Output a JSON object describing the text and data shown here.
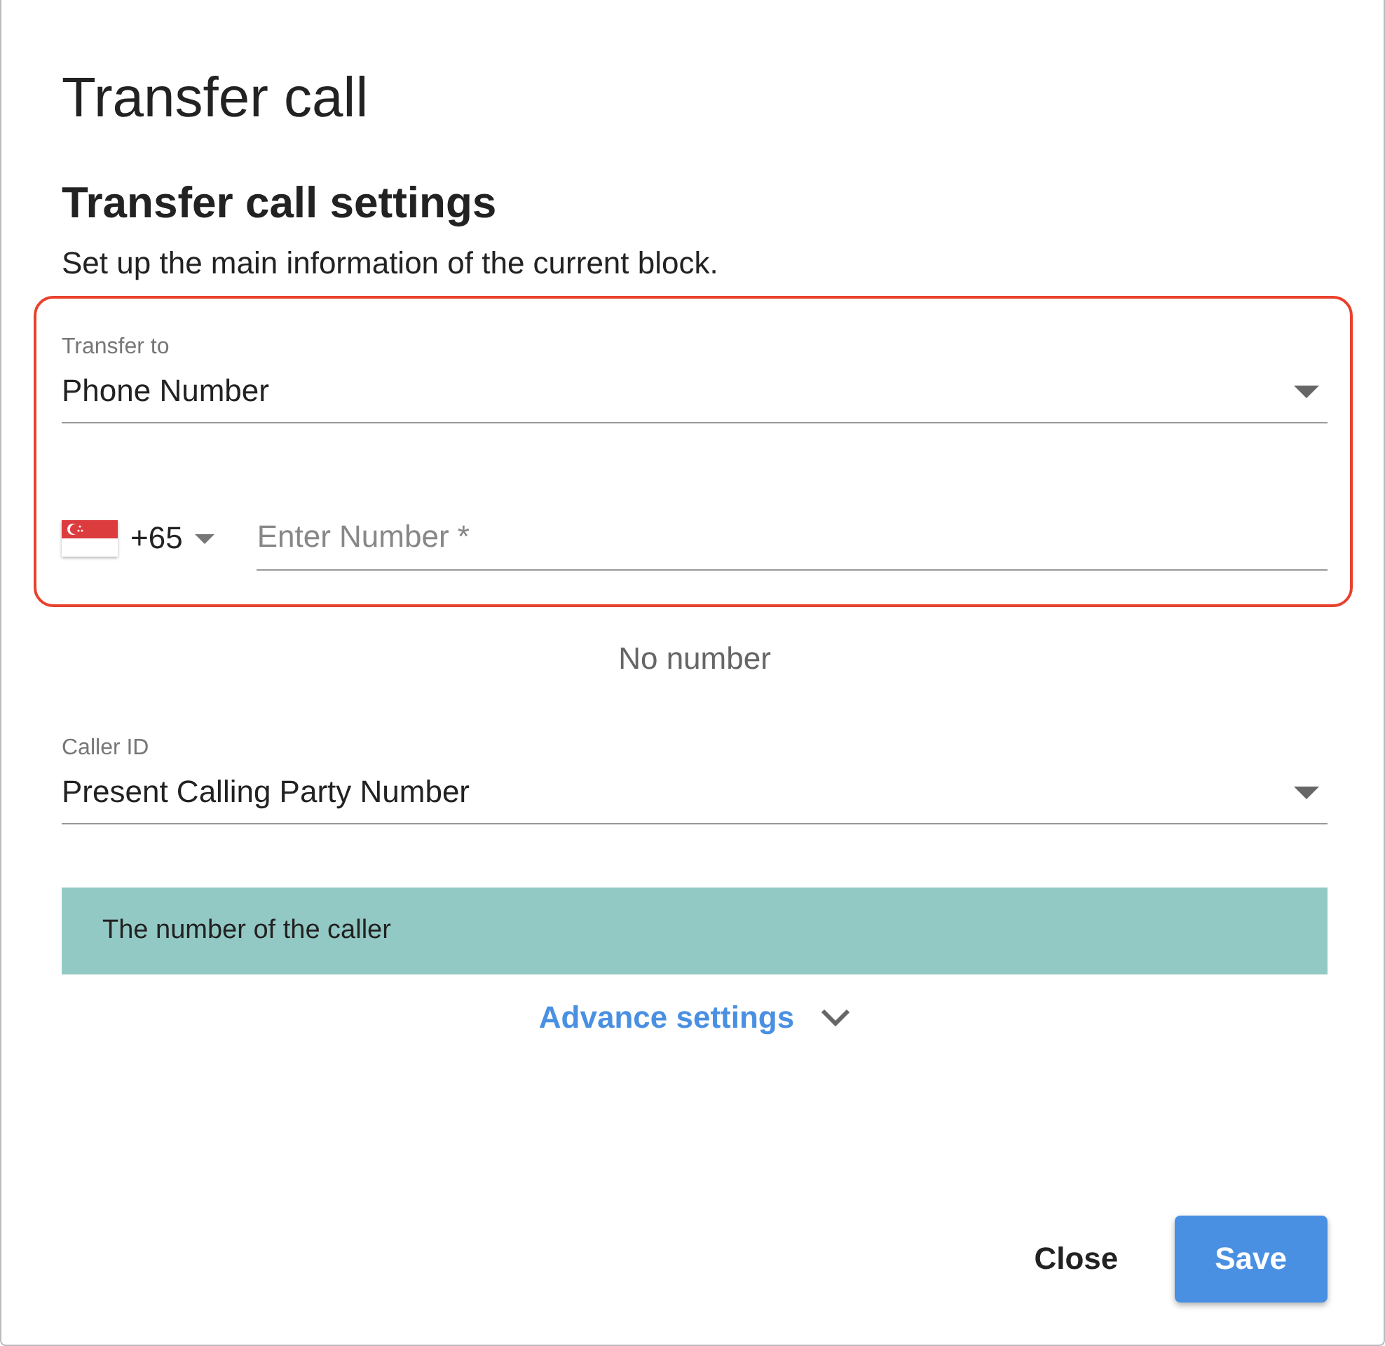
{
  "dialog": {
    "title": "Transfer call"
  },
  "section": {
    "heading": "Transfer call settings",
    "description": "Set up the main information of the current block."
  },
  "transfer_to": {
    "label": "Transfer to",
    "value": "Phone Number"
  },
  "phone": {
    "country_code": "+65",
    "placeholder": "Enter Number *"
  },
  "phone_status": "No number",
  "caller_id": {
    "label": "Caller ID",
    "value": "Present Calling Party Number"
  },
  "info_banner": "The number of the caller",
  "advanced": {
    "label": "Advance settings",
    "expanded": false
  },
  "buttons": [
    {
      "label": "Close",
      "kind": "text"
    },
    {
      "label": "Save",
      "kind": "primary"
    }
  ]
}
